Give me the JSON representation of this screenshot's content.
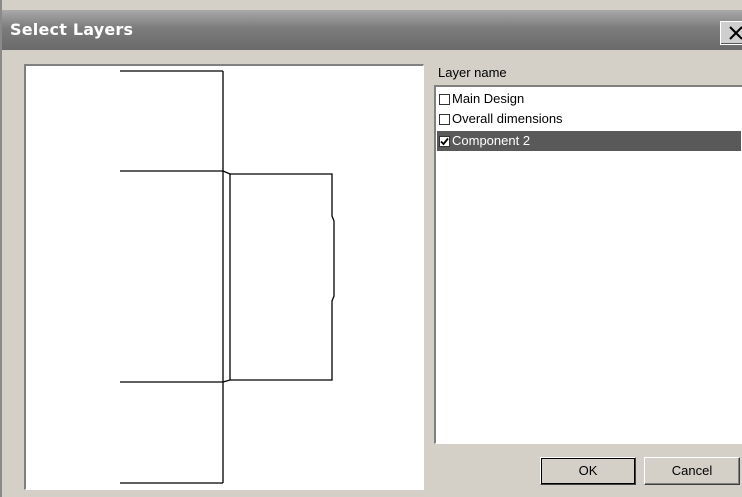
{
  "window": {
    "title": "Select Layers"
  },
  "layers": {
    "column_header": "Layer name",
    "items": [
      {
        "label": "Main Design",
        "checked": false,
        "selected": false
      },
      {
        "label": "Overall dimensions",
        "checked": false,
        "selected": false
      },
      {
        "label": "Component 2",
        "checked": true,
        "selected": true
      }
    ]
  },
  "buttons": {
    "ok_label": "OK",
    "cancel_label": "Cancel"
  },
  "icons": {
    "close": "close-icon",
    "checkbox_checked": "check-icon"
  },
  "colors": {
    "titlebar": "#7c7c7c",
    "dialog_face": "#d4d0c8",
    "selection": "#595959"
  }
}
